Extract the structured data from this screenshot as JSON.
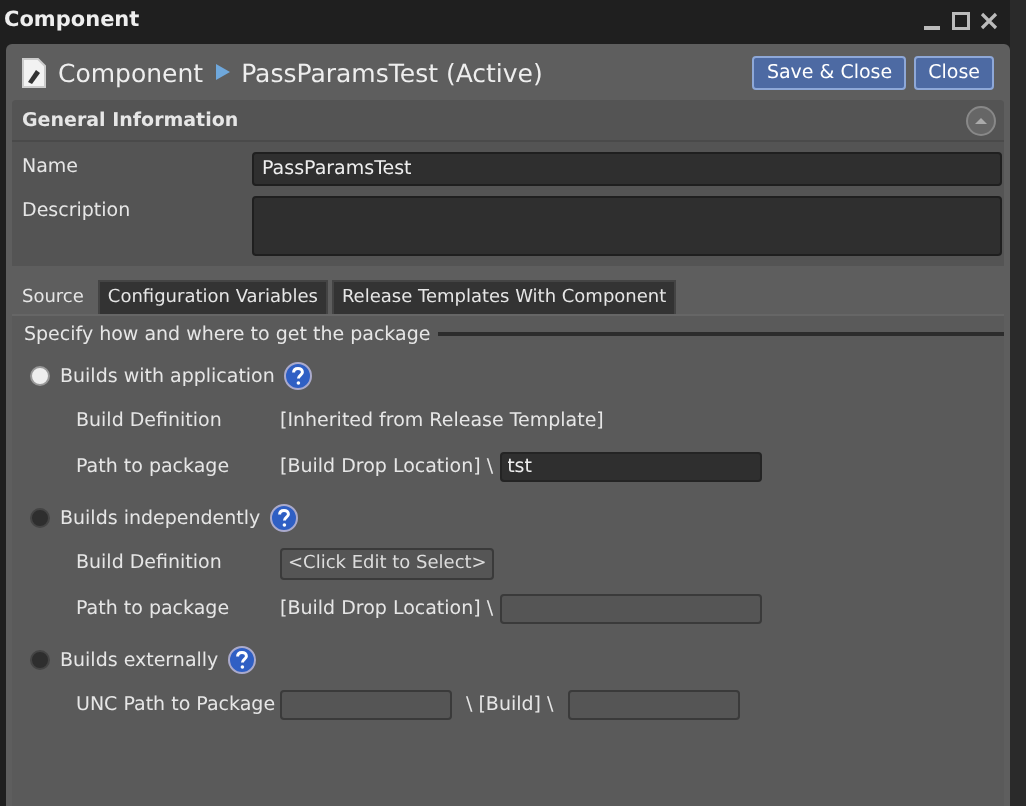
{
  "window": {
    "title": "Component"
  },
  "header": {
    "breadcrumb": [
      "Component",
      "PassParamsTest (Active)"
    ],
    "buttons": [
      "Save & Close",
      "Close"
    ]
  },
  "general": {
    "title": "General Information",
    "expanded": true,
    "fields": [
      {
        "label": "Name",
        "kind": "line",
        "value": "PassParamsTest"
      },
      {
        "label": "Description",
        "kind": "area"
      }
    ]
  },
  "tabs": [
    {
      "label": "Source",
      "selected": true
    },
    {
      "label": "Configuration Variables",
      "selected": false
    },
    {
      "label": "Release Templates With Component",
      "selected": false
    }
  ],
  "source": {
    "legend": "Specify how and where to get the package",
    "options": [
      {
        "label": "Builds with application",
        "selected": true,
        "rows": [
          {
            "label": "Build Definition",
            "kind": "text",
            "text": "[Inherited from Release Template]"
          },
          {
            "label": "Path to package",
            "kind": "path",
            "prefix": "[Build Drop Location] \\",
            "value": "tst"
          }
        ]
      },
      {
        "label": "Builds independently",
        "selected": false,
        "rows": [
          {
            "label": "Build Definition",
            "kind": "picker",
            "text": "<Click Edit to Select>"
          },
          {
            "label": "Path to package",
            "kind": "path",
            "prefix": "[Build Drop Location] \\"
          }
        ]
      },
      {
        "label": "Builds externally",
        "selected": false,
        "rows": [
          {
            "label": "UNC Path to Package",
            "kind": "unc",
            "middle": "\\ [Build] \\"
          }
        ]
      }
    ]
  }
}
